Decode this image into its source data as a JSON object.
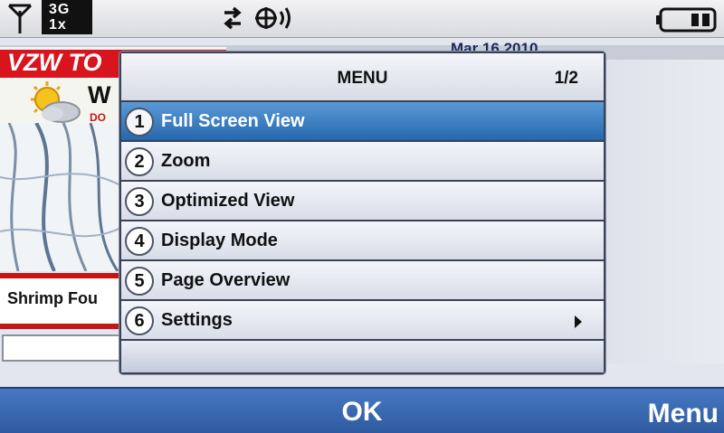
{
  "status_bar": {
    "network_line1": "3G",
    "network_line2": "1x",
    "icons": [
      "signal-icon",
      "data-transfer-icon",
      "roaming-icon",
      "battery-icon"
    ]
  },
  "background_page": {
    "date": "Mar 16 2010",
    "logo": "VZW TO",
    "weather_heading": "W",
    "weather_sub": "DO",
    "headline": "Shrimp Fou"
  },
  "menu": {
    "title": "MENU",
    "page": "1/2",
    "items": [
      {
        "number": "1",
        "label": "Full Screen View",
        "selected": true
      },
      {
        "number": "2",
        "label": "Zoom"
      },
      {
        "number": "3",
        "label": "Optimized View"
      },
      {
        "number": "4",
        "label": "Display Mode"
      },
      {
        "number": "5",
        "label": "Page Overview"
      },
      {
        "number": "6",
        "label": "Settings",
        "has_submenu": true
      }
    ]
  },
  "softkeys": {
    "center": "OK",
    "right": "Menu"
  },
  "colors": {
    "selected_item": "#2f74bf",
    "softkey_bar": "#3a6cb4",
    "logo_red": "#d8141e"
  }
}
